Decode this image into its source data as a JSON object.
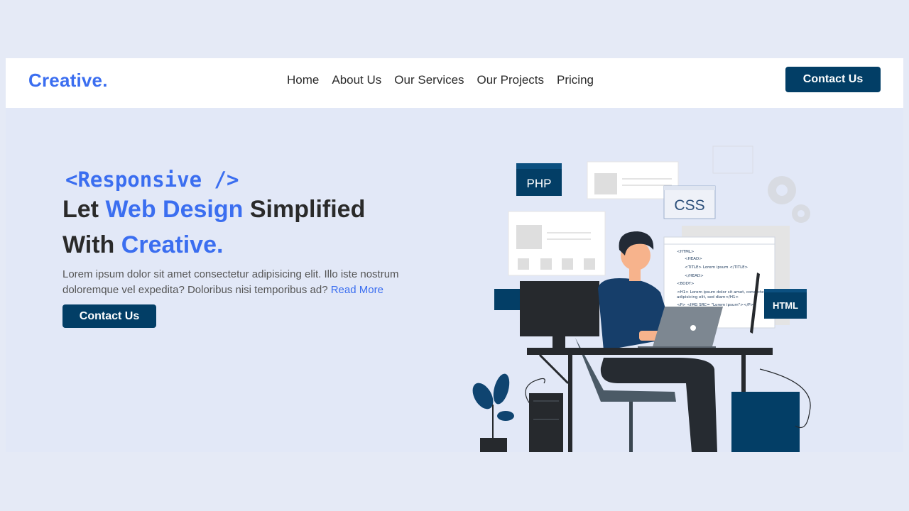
{
  "brand": {
    "logo": "Creative."
  },
  "nav": {
    "links": [
      "Home",
      "About Us",
      "Our Services",
      "Our Projects",
      "Pricing"
    ],
    "cta": "Contact Us"
  },
  "hero": {
    "tagline": "<Responsive />",
    "headline": {
      "line1_pre": "Let ",
      "line1_highlight": "Web Design",
      "line1_post": " Simplified",
      "line2_pre": "With ",
      "line2_highlight": "Creative."
    },
    "description": "Lorem ipsum dolor sit amet consectetur adipisicing elit. Illo iste nostrum doloremque vel expedita? Doloribus nisi temporibus ad? ",
    "read_more": "Read More",
    "cta": "Contact Us"
  },
  "illustration": {
    "labels": {
      "php": "PHP",
      "css": "CSS",
      "html": "HTML"
    },
    "code_lines": [
      "<HTML>",
      "<HEAD>",
      "<TITLE> Lorem ipsum </TITLE>",
      "</HEAD>",
      "<BODY>",
      "<H1> Lorem ipsum dolor sit amet, consectetur",
      "adipisicing elit, sed diam</H1>",
      "<P> <IMG SRC= \"Lorem ipsum\"></P>"
    ]
  },
  "colors": {
    "accent": "#3b6ef0",
    "navy": "#023e66",
    "background": "#e2e8f7"
  }
}
